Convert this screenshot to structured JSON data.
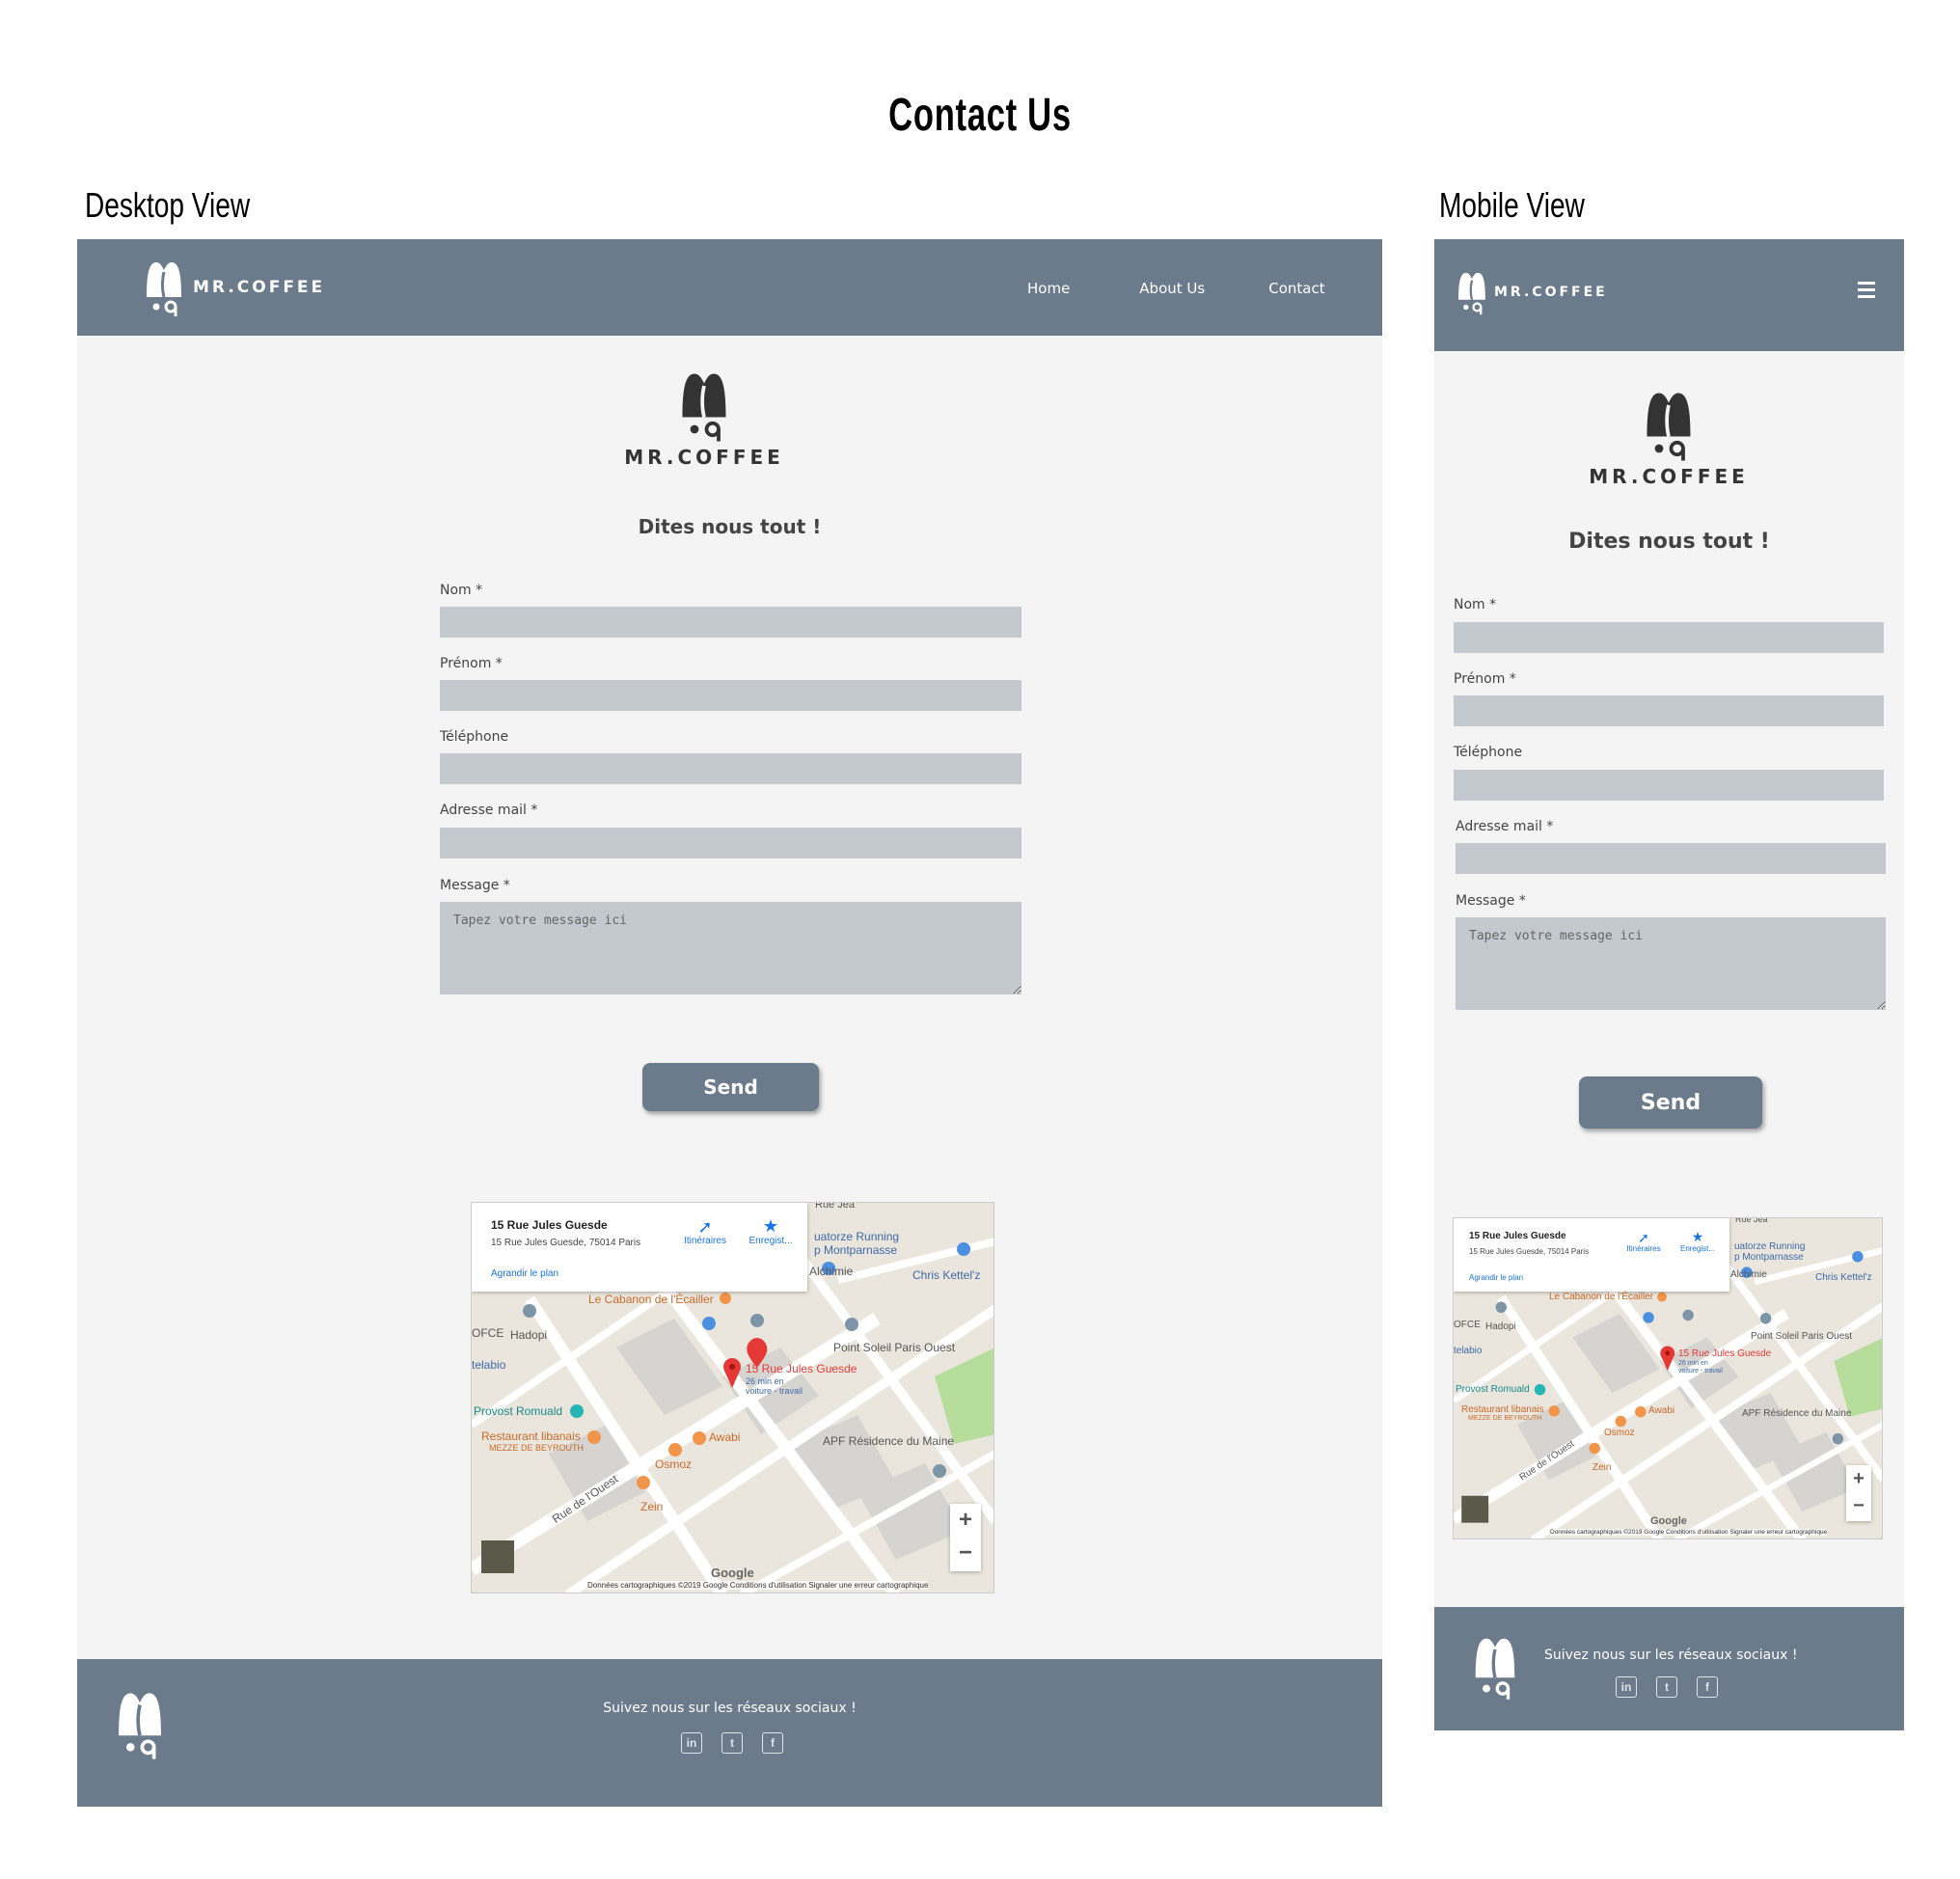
{
  "page": {
    "title": "Contact Us"
  },
  "labels": {
    "desktop": "Desktop View",
    "mobile": "Mobile View"
  },
  "brand": {
    "name": "MR.COFFEE"
  },
  "nav": {
    "home": "Home",
    "about": "About Us",
    "contact": "Contact"
  },
  "form": {
    "tagline": "Dites nous tout !",
    "nom_label": "Nom *",
    "prenom_label": "Prénom *",
    "telephone_label": "Téléphone",
    "email_label": "Adresse mail *",
    "message_label": "Message *",
    "message_placeholder": "Tapez votre message ici",
    "send_label": "Send"
  },
  "map": {
    "address_title": "15 Rue Jules Guesde",
    "address_line": "15 Rue Jules Guesde, 75014 Paris",
    "enlarge": "Agrandir le plan",
    "directions": "Itinéraires",
    "save": "Enregist...",
    "pin_label": "15 Rue Jules Guesde",
    "pin_sub1": "26 min en",
    "pin_sub2": "voiture - travail",
    "places": {
      "quatorze": "uatorze Running",
      "montparnasse": "p Montparnasse",
      "alchimie": "Alchimie",
      "chris": "Chris Kettel'z",
      "cabanon": "Le Cabanon de l'Écailler",
      "ofce": "OFCE",
      "hadopi": "Hadopi",
      "soleil": "Point Soleil Paris Ouest",
      "telabio": "telabio",
      "provost": "Provost Romuald",
      "restaurant": "Restaurant libanais",
      "mezze": "MEZZE DE BEYROUTH",
      "awabi": "Awabi",
      "apf": "APF Résidence du Maine",
      "osmoz": "Osmoz",
      "zein": "Zein",
      "rue_ouest": "Rue de l'Ouest",
      "rue_top": "Rue Jea",
      "google": "Google"
    },
    "footer": "Données cartographiques ©2019 Google   Conditions d'utilisation   Signaler une erreur cartographique",
    "zoom_in": "+",
    "zoom_out": "−",
    "colors": {
      "land": "#ebe6dd",
      "road": "#ffffff",
      "building": "#d6d4d0",
      "park": "#b6dd9c",
      "pin": "#e53935",
      "poi_orange": "#f0954a",
      "poi_blue": "#4b8fe0"
    }
  },
  "footer": {
    "social": "Suivez nous sur les réseaux sociaux !",
    "linkedin": "in",
    "twitter": "t",
    "facebook": "f"
  },
  "colors": {
    "nav": "#6b7b8b",
    "page_bg": "#f4f4f4",
    "input_bg": "#c4c9cf"
  }
}
